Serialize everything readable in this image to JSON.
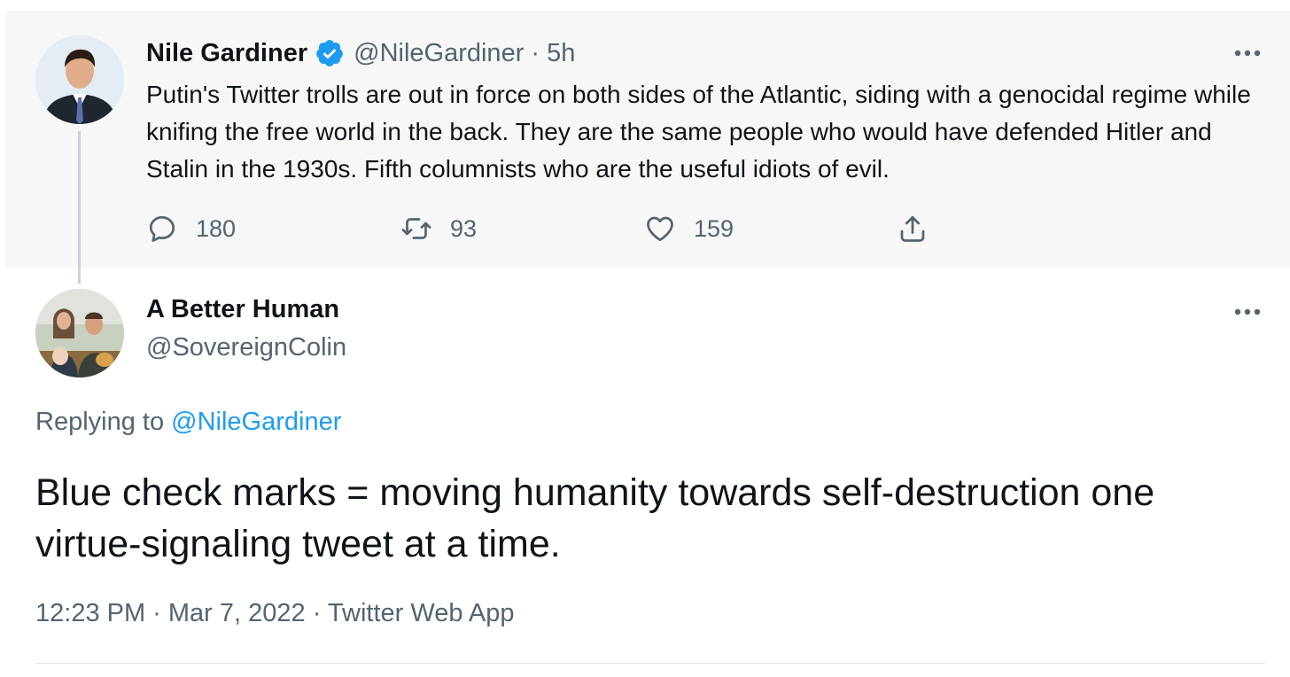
{
  "parent_tweet": {
    "author": {
      "name": "Nile Gardiner",
      "handle_time": "@NileGardiner · 5h",
      "verified": true
    },
    "text": "Putin's Twitter trolls are out in force on both sides of the Atlantic, siding with a genocidal regime while knifing the free world in the back. They are the same people who would have defended Hitler and Stalin in the 1930s. Fifth columnists who are the useful idiots of evil.",
    "actions": {
      "replies": "180",
      "retweets": "93",
      "likes": "159"
    }
  },
  "reply_tweet": {
    "author": {
      "name": "A Better Human",
      "handle": "@SovereignColin"
    },
    "replying_to_label": "Replying to",
    "replying_to_handle": "@NileGardiner",
    "text": "Blue check marks = moving humanity towards self-destruction one virtue-signaling tweet at a time.",
    "meta": "12:23 PM · Mar 7, 2022 · Twitter Web App"
  },
  "colors": {
    "accent": "#1d9bf0",
    "text": "#0f1419",
    "muted": "#536471",
    "parent_background": "#f7f7f7"
  }
}
